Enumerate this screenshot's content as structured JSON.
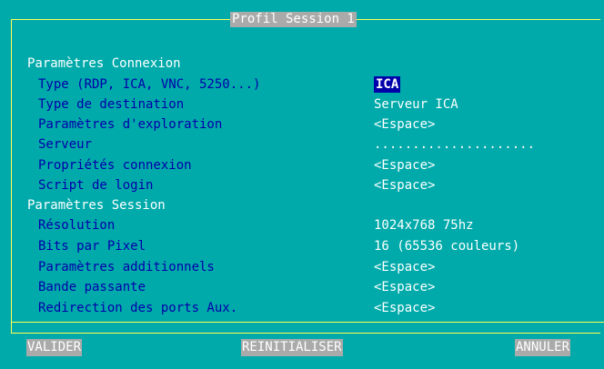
{
  "window": {
    "title": "Profil Session 1"
  },
  "sections": {
    "connexion": {
      "title": "Paramètres Connexion",
      "rows": [
        {
          "label": "Type (RDP, ICA, VNC, 5250...)",
          "value": "ICA"
        },
        {
          "label": "Type de destination",
          "value": "Serveur ICA"
        },
        {
          "label": "Paramètres d'exploration",
          "value": "<Espace>"
        },
        {
          "label": "Serveur",
          "value": "....................."
        },
        {
          "label": "Propriétés connexion",
          "value": "<Espace>"
        },
        {
          "label": "Script de login",
          "value": "<Espace>"
        }
      ]
    },
    "session": {
      "title": "Paramètres Session",
      "rows": [
        {
          "label": "Résolution",
          "value": "1024x768 75hz"
        },
        {
          "label": "Bits par Pixel",
          "value": "16 (65536 couleurs)"
        },
        {
          "label": "Paramètres additionnels",
          "value": "<Espace>"
        },
        {
          "label": "Bande passante",
          "value": "<Espace>"
        },
        {
          "label": "Redirection des ports Aux.",
          "value": "<Espace>"
        }
      ]
    }
  },
  "buttons": {
    "validate": "VALIDER",
    "reset": "REINITIALISER",
    "cancel": "ANNULER"
  },
  "colors": {
    "background": "#00aaaa",
    "frame": "#ffff55",
    "label": "#0000aa",
    "value": "#ffffff",
    "selected_bg": "#0000aa",
    "button_bg": "#aaaaaa"
  }
}
